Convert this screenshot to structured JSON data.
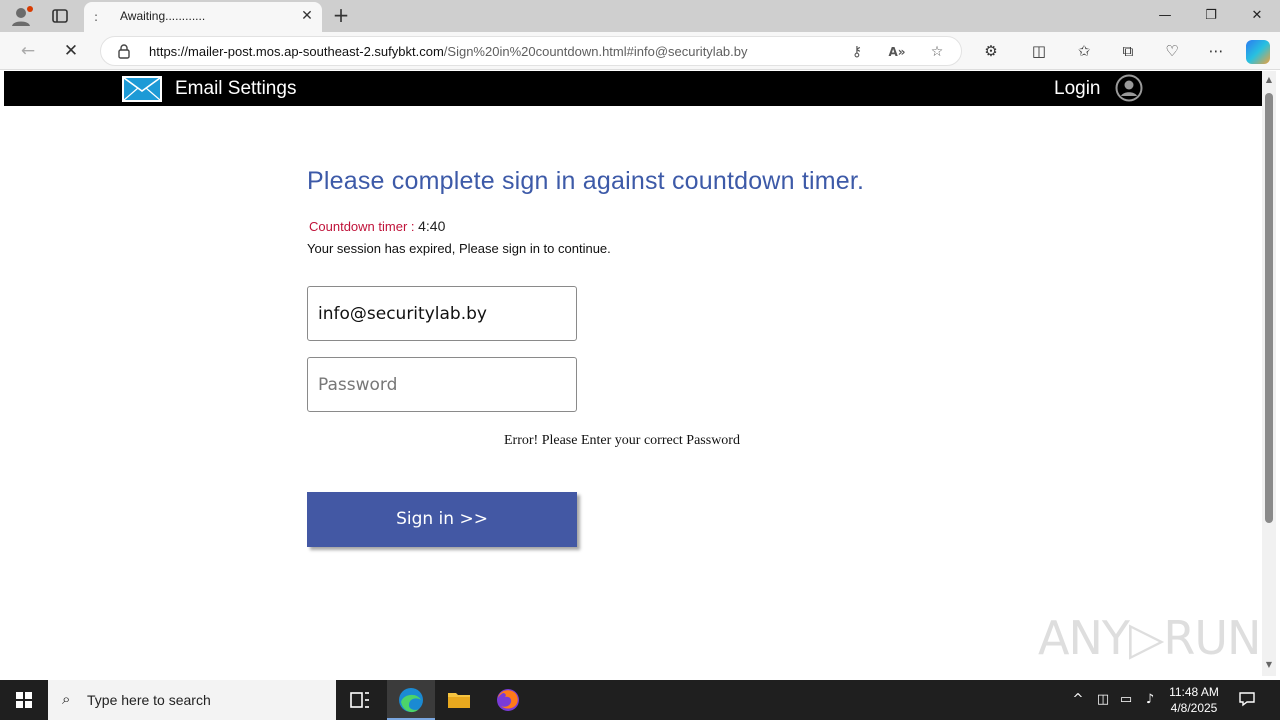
{
  "browser": {
    "tab_title": "Awaiting............",
    "tab_loading_glyph": ":",
    "tab_close": "✕",
    "new_tab": "+",
    "url_host": "https://mailer-post.mos.ap-southeast-2.sufybkt.com",
    "url_path": "/Sign%20in%20countdown.html#info@securitylab.by",
    "window_controls": {
      "minimize": "—",
      "restore": "❐",
      "close": "✕"
    }
  },
  "site": {
    "title": "Email Settings",
    "login": "Login"
  },
  "form": {
    "heading": "Please complete sign in against countdown timer.",
    "countdown_label": "Countdown timer :",
    "countdown_value": "4:40",
    "session_msg": "Your session has expired, Please sign in to continue.",
    "email_value": "info@securitylab.by",
    "password_placeholder": "Password",
    "error_msg": "Error! Please Enter your correct Password",
    "signin_label": "Sign in >>"
  },
  "watermark": "ANY▷RUN",
  "taskbar": {
    "search_placeholder": "Type here to search",
    "time": "11:48 AM",
    "date": "4/8/2025"
  },
  "colors": {
    "heading": "#3d5aa8",
    "countdown_label": "#c0133a",
    "signin_bg": "#4358a4",
    "header_bg": "#000000"
  }
}
